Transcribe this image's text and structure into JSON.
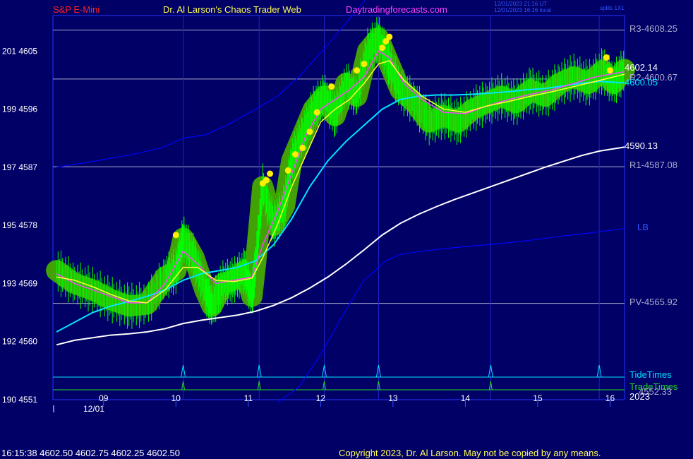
{
  "header": {
    "symbol": "S&P E-Mini",
    "site": "Dr. Al Larson's Chaos Trader Web",
    "url": "Daytradingforecasts.com",
    "ut_stamp": "12/01/2023 21:16 UT",
    "local_stamp": "12/01/2023 16:16 local",
    "option": "splits 1X1"
  },
  "colors": {
    "background": "#000066",
    "price_bars": "#00ff00",
    "ema_short": "#ff44ff",
    "ema_mid": "#ffff33",
    "ema_cyan": "#00e5ff",
    "ema_white": "#ffffff",
    "band": "#0000ff",
    "vertical_lines": "#2222cc",
    "pivot_lines": "#aaaacc",
    "highlight": "#44aa00",
    "peak_dots": "#ffee00"
  },
  "chart_data": {
    "type": "line",
    "x_axis": {
      "tick_labels": [
        "09",
        "10",
        "11",
        "12",
        "13",
        "14",
        "15",
        "16"
      ],
      "date_label": "12/01",
      "year_label": "2023",
      "range": [
        8.2,
        16.1
      ]
    },
    "y_axis": {
      "tick_labels": [
        "201  4605",
        "199  4596",
        "197  4587",
        "195  4578",
        "193  4569",
        "192  4560",
        "190  4551"
      ],
      "tick_values": [
        4605,
        4596,
        4587,
        4578,
        4569,
        4560,
        4551
      ],
      "range": [
        4551,
        4610.5
      ]
    },
    "horizontal_levels": [
      {
        "label": "R3-4608.25",
        "value": 4608.25
      },
      {
        "label": "R2-4600.67",
        "value": 4600.67
      },
      {
        "label": "R1-4587.08",
        "value": 4587.08
      },
      {
        "label": "PV-4565.92",
        "value": 4565.92
      }
    ],
    "vertical_times": [
      10.0,
      11.05,
      11.95,
      12.7,
      14.25,
      15.75
    ],
    "series": [
      {
        "name": "price",
        "x": [
          8.25,
          8.5,
          8.75,
          9.0,
          9.25,
          9.5,
          9.75,
          9.9,
          10.0,
          10.15,
          10.3,
          10.4,
          10.55,
          10.7,
          10.85,
          10.95,
          11.0,
          11.1,
          11.25,
          11.4,
          11.5,
          11.65,
          11.8,
          11.95,
          12.1,
          12.25,
          12.4,
          12.55,
          12.7,
          12.85,
          13.0,
          13.2,
          13.4,
          13.6,
          13.8,
          14.0,
          14.2,
          14.4,
          14.6,
          14.8,
          15.0,
          15.2,
          15.4,
          15.6,
          15.8,
          15.95,
          16.1
        ],
        "y": [
          4571,
          4569,
          4568,
          4566.5,
          4565.5,
          4565.8,
          4570,
          4571,
          4576,
          4573,
          4568,
          4565.5,
          4569,
          4569.5,
          4571,
          4567,
          4572,
          4584,
          4578,
          4581,
          4588,
          4592,
          4596,
          4598,
          4595,
          4600,
          4598,
          4605,
          4607,
          4603,
          4599,
          4597,
          4594,
          4595,
          4594,
          4596,
          4597,
          4598,
          4597,
          4599,
          4598,
          4600,
          4601,
          4600,
          4602,
          4600,
          4602.14
        ]
      },
      {
        "name": "ema_short",
        "x": [
          8.25,
          8.5,
          8.75,
          9.0,
          9.25,
          9.5,
          9.75,
          10.0,
          10.2,
          10.45,
          10.7,
          10.95,
          11.1,
          11.3,
          11.5,
          11.7,
          11.9,
          12.1,
          12.3,
          12.5,
          12.7,
          12.85,
          13.05,
          13.3,
          13.6,
          13.9,
          14.2,
          14.5,
          14.8,
          15.1,
          15.4,
          15.7,
          15.95,
          16.1
        ],
        "y": [
          4570.5,
          4569,
          4568,
          4567,
          4566,
          4566,
          4569,
          4574,
          4572,
          4569,
          4569.5,
          4570,
          4575,
          4580,
          4586,
          4592,
          4596,
          4597.5,
          4599,
          4601,
          4605,
          4604,
          4600,
          4597.5,
          4595.5,
          4595.3,
          4596.5,
          4597.5,
          4598.3,
          4599,
          4600,
          4601,
          4601.5,
          4601.8
        ]
      },
      {
        "name": "ema_mid",
        "x": [
          8.25,
          8.5,
          8.75,
          9.0,
          9.25,
          9.5,
          9.75,
          10.0,
          10.2,
          10.45,
          10.7,
          10.95,
          11.1,
          11.3,
          11.5,
          11.7,
          11.9,
          12.1,
          12.3,
          12.5,
          12.7,
          12.85,
          13.05,
          13.3,
          13.6,
          13.9,
          14.2,
          14.5,
          14.8,
          15.1,
          15.4,
          15.7,
          15.95,
          16.1
        ],
        "y": [
          4570,
          4569.5,
          4568.5,
          4567.3,
          4566.3,
          4566,
          4568,
          4571.5,
          4571.5,
          4569.5,
          4569.3,
          4569.8,
          4573,
          4578,
          4584,
          4589,
          4594,
          4596,
          4597.5,
          4600,
          4603,
          4603.5,
          4600.5,
          4598,
          4596,
          4595.5,
          4596.5,
          4597.2,
          4598,
          4598.7,
          4599.5,
          4600.3,
          4601,
          4601.4
        ]
      },
      {
        "name": "ema_cyan",
        "x": [
          8.25,
          8.5,
          8.75,
          9.0,
          9.25,
          9.5,
          9.75,
          10.0,
          10.25,
          10.5,
          10.75,
          11.0,
          11.25,
          11.5,
          11.75,
          12.0,
          12.25,
          12.5,
          12.75,
          13.0,
          13.25,
          13.5,
          13.75,
          14.0,
          14.25,
          14.5,
          14.75,
          15.0,
          15.25,
          15.5,
          15.75,
          16.1
        ],
        "y": [
          4561.5,
          4563,
          4564.5,
          4565.5,
          4566.2,
          4567,
          4568,
          4569.5,
          4570.5,
          4571,
          4571.5,
          4572.5,
          4575,
          4579,
          4584,
          4588,
          4591,
          4593.5,
          4596,
          4597.5,
          4598,
          4598.2,
          4598.2,
          4598.3,
          4598.5,
          4598.7,
          4599,
          4599.2,
          4599.6,
          4600,
          4600.3,
          4600.05
        ]
      },
      {
        "name": "ema_white",
        "x": [
          8.25,
          8.5,
          8.75,
          9.0,
          9.25,
          9.5,
          9.75,
          10.0,
          10.25,
          10.5,
          10.75,
          11.0,
          11.25,
          11.5,
          11.75,
          12.0,
          12.25,
          12.5,
          12.75,
          13.0,
          13.25,
          13.5,
          13.75,
          14.0,
          14.25,
          14.5,
          14.75,
          15.0,
          15.25,
          15.5,
          15.75,
          16.1
        ],
        "y": [
          4559.5,
          4560.2,
          4560.6,
          4561,
          4561.2,
          4561.5,
          4562,
          4562.8,
          4563.3,
          4563.7,
          4564.1,
          4564.7,
          4565.6,
          4566.8,
          4568.3,
          4570,
          4572,
          4574.2,
          4576.5,
          4578.3,
          4579.7,
          4580.9,
          4582,
          4583,
          4584,
          4585,
          4586,
          4587,
          4587.9,
          4588.8,
          4589.5,
          4590.13
        ]
      },
      {
        "name": "band_upper",
        "x": [
          8.25,
          8.8,
          9.3,
          9.7,
          10.0,
          10.3,
          10.6,
          11.0,
          11.3,
          11.6,
          12.0,
          12.3,
          12.6,
          12.85
        ],
        "y": [
          4587,
          4588,
          4589,
          4590,
          4591.5,
          4592,
          4593.5,
          4596,
          4598,
          4601,
          4606,
          4610,
          4614,
          4618
        ]
      },
      {
        "name": "band_lower",
        "x": [
          11.3,
          11.6,
          11.9,
          12.2,
          12.5,
          12.8,
          13.0,
          13.3,
          13.7,
          14.0,
          14.4,
          14.8,
          15.2,
          15.6,
          15.95,
          16.1
        ],
        "y": [
          4550.5,
          4553,
          4558,
          4564,
          4569.5,
          4572.5,
          4573.5,
          4574,
          4574.5,
          4574.8,
          4575.2,
          4575.7,
          4576.3,
          4576.8,
          4577.3,
          4577.5
        ]
      }
    ],
    "peak_dots": {
      "x": [
        9.9,
        11.1,
        11.15,
        11.2,
        11.45,
        11.55,
        11.65,
        11.75,
        11.85,
        12.05,
        12.4,
        12.5,
        12.75,
        12.8,
        12.85,
        15.85,
        15.9
      ],
      "y": [
        4576.5,
        4584.5,
        4585,
        4586,
        4586.5,
        4589,
        4590,
        4592.5,
        4595.5,
        4599.5,
        4602,
        4603,
        4605.5,
        4606.5,
        4607.2,
        4604,
        4602
      ]
    },
    "right_labels": {
      "price": "4602.14",
      "cyan": "4600.05",
      "white": "4590.13",
      "band": "LB"
    },
    "cycle_lines": {
      "tide_label": "TideTimes",
      "trade_label": "TradeTimes",
      "trade_value_label": "4552.33"
    }
  },
  "footer": {
    "quote": "16:15:38  4602.50 4602.75 4602.25 4602.50",
    "copyright": "Copyright 2023, Dr. Al Larson. May not be copied by any means."
  }
}
